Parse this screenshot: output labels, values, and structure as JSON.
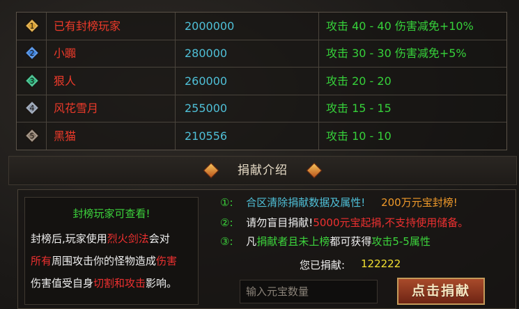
{
  "ranking": [
    {
      "rank": "1",
      "name": "已有封榜玩家",
      "amount": "2000000",
      "attribute": "攻击 40 - 40  伤害减免+10%",
      "badge_color": "#d8a030"
    },
    {
      "rank": "2",
      "name": "小嚻",
      "amount": "280000",
      "attribute": "攻击 30 - 30  伤害减免+5%",
      "badge_color": "#3a7ed8"
    },
    {
      "rank": "3",
      "name": "狠人",
      "amount": "260000",
      "attribute": "攻击 20 - 20",
      "badge_color": "#2ab07a"
    },
    {
      "rank": "4",
      "name": "风花雪月",
      "amount": "255000",
      "attribute": "攻击 15 - 15",
      "badge_color": "#8a96a8"
    },
    {
      "rank": "5",
      "name": "黑猫",
      "amount": "210556",
      "attribute": "攻击 10 - 10",
      "badge_color": "#8a7a6a"
    }
  ],
  "section_title": "捐献介绍",
  "intro": {
    "title": "封榜玩家可查看!",
    "line1_a": "封榜后,玩家使用",
    "line1_b": "烈火剑法",
    "line1_c": "会对",
    "line2_a": "所有",
    "line2_b": "周围攻击你的怪物造成",
    "line2_c": "伤害",
    "line3_a": "伤害值受自身",
    "line3_b": "切割和攻击",
    "line3_c": "影响。"
  },
  "rules": {
    "r1_num": "①:",
    "r1_a": "合区清除捐献数据及属性!",
    "r1_b": "200万元宝封榜!",
    "r2_num": "②:",
    "r2_a": "请勿盲目捐献!",
    "r2_b": "5000元宝起捐,",
    "r2_c": "不支持使用储备。",
    "r3_num": "③:",
    "r3_a": "凡",
    "r3_b": "捐献者且未上榜",
    "r3_c": "都可获得",
    "r3_d": "攻击5-5属性"
  },
  "donated_label": "您已捐献:",
  "donated_value": "122222",
  "input_placeholder": "输入元宝数量",
  "donate_button": "点击捐献"
}
